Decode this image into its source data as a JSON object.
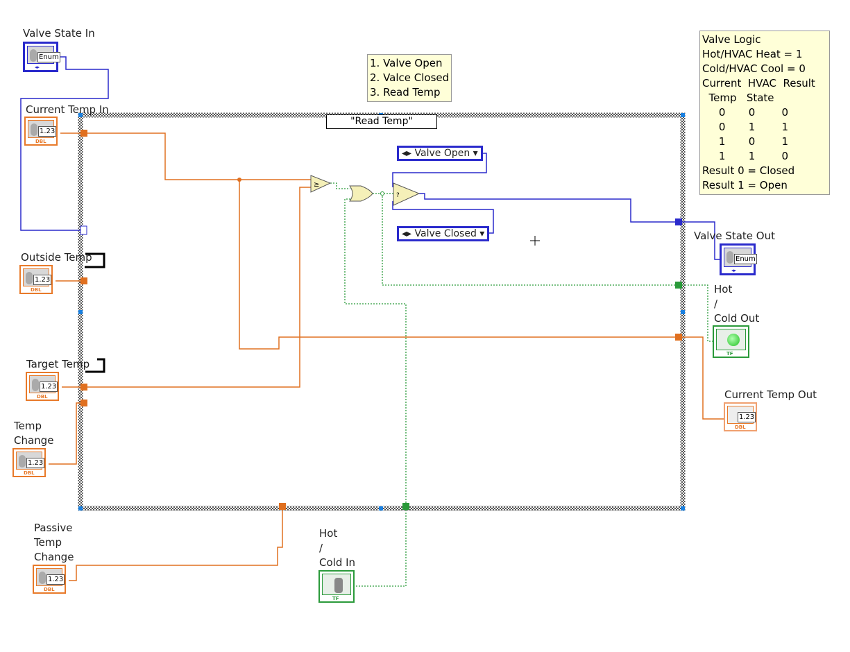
{
  "terminals": {
    "valve_state_in": {
      "label": "Valve State In",
      "value": "Enum"
    },
    "current_temp_in": {
      "label": "Current Temp In",
      "value": "1.23",
      "type": "DBL"
    },
    "outside_temp": {
      "label": "Outside Temp",
      "value": "1.23",
      "type": "DBL"
    },
    "target_temp": {
      "label": "Target Temp",
      "value": "1.23",
      "type": "DBL"
    },
    "temp_change": {
      "label": "Temp\nChange",
      "value": "1.23",
      "type": "DBL"
    },
    "passive_temp_change": {
      "label": "Passive\nTemp\nChange",
      "value": "1.23",
      "type": "DBL"
    },
    "hot_cold_in": {
      "label": "Hot\n/\nCold In",
      "type": "TF"
    },
    "valve_state_out": {
      "label": "Valve State Out",
      "value": "Enum"
    },
    "hot_cold_out": {
      "label": "Hot\n/\nCold Out",
      "type": "TF"
    },
    "current_temp_out": {
      "label": "Current Temp Out",
      "value": "1.23",
      "type": "DBL"
    }
  },
  "case_selector": "\"Read Temp\"",
  "constants": {
    "valve_open": "Valve Open",
    "valve_closed": "Valve Closed"
  },
  "comment_states": "1. Valve Open\n2. Valce Closed\n3. Read Temp",
  "comment_logic": "Valve Logic\nHot/HVAC Heat = 1\nCold/HVAC Cool = 0\nCurrent  HVAC  Result\n  Temp   State\n     0       0        0\n     0       1        1\n     1       0        1\n     1       1        0\nResult 0 = Closed\nResult 1 = Open",
  "colors": {
    "numeric_wire": "#e07020",
    "enum_wire": "#2a2acc",
    "boolean_wire": "#2a9a3a"
  }
}
